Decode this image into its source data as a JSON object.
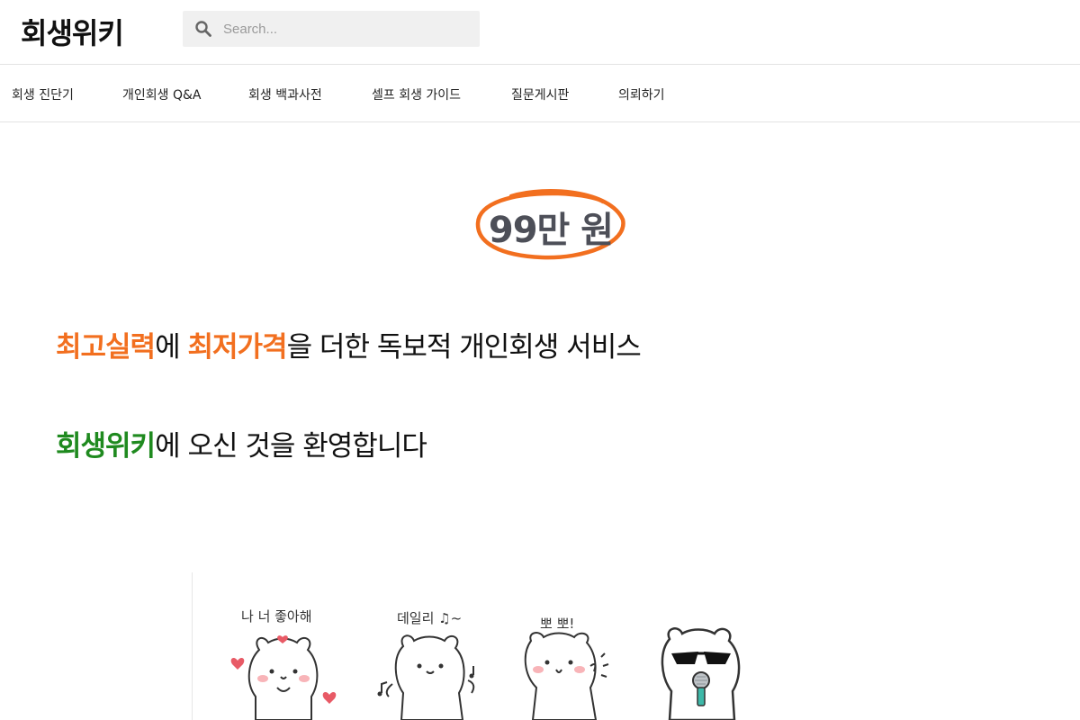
{
  "header": {
    "logo": "회생위키",
    "search_placeholder": "Search..."
  },
  "nav": {
    "items": [
      {
        "label": "회생 진단기"
      },
      {
        "label": "개인회생 Q&A"
      },
      {
        "label": "회생 백과사전"
      },
      {
        "label": "셀프 회생 가이드"
      },
      {
        "label": "질문게시판"
      },
      {
        "label": "의뢰하기"
      }
    ]
  },
  "hero": {
    "price": "99만 원",
    "line1": {
      "highlight1": "최고실력",
      "text1": "에 ",
      "highlight2": "최저가격",
      "text2": "을 더한 독보적 개인회생 서비스"
    },
    "line2": {
      "highlight": "회생위키",
      "text": "에 오신 것을 환영합니다"
    }
  },
  "stickers": [
    {
      "caption": "나 너 좋아해",
      "icon": "bear-love-icon"
    },
    {
      "caption": "데일리 ♫~",
      "icon": "bear-dance-icon"
    },
    {
      "caption": "뽀 뽀!",
      "icon": "bear-kiss-icon"
    },
    {
      "caption": "",
      "icon": "bear-sunglasses-mic-icon"
    }
  ],
  "colors": {
    "accent_orange": "#f26f1f",
    "accent_green": "#1f8a1f",
    "price_text": "#4d4f58"
  }
}
